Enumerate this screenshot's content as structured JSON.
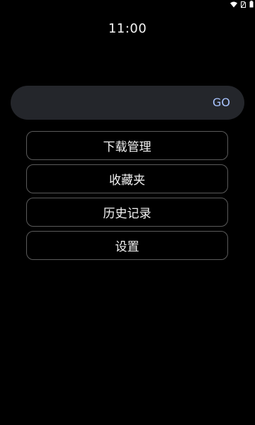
{
  "status_bar": {
    "icons": [
      "wifi-icon",
      "no-sim-icon",
      "battery-icon"
    ]
  },
  "clock": "11:00",
  "search": {
    "value": "",
    "placeholder": "",
    "go_label": "GO"
  },
  "menu": {
    "items": [
      {
        "label": "下载管理"
      },
      {
        "label": "收藏夹"
      },
      {
        "label": "历史记录"
      },
      {
        "label": "设置"
      }
    ]
  },
  "colors": {
    "background": "#000000",
    "search_bg": "#24262b",
    "go_accent": "#a9c4ff",
    "menu_border": "#5a5a5a",
    "text": "#f2f2f2"
  }
}
